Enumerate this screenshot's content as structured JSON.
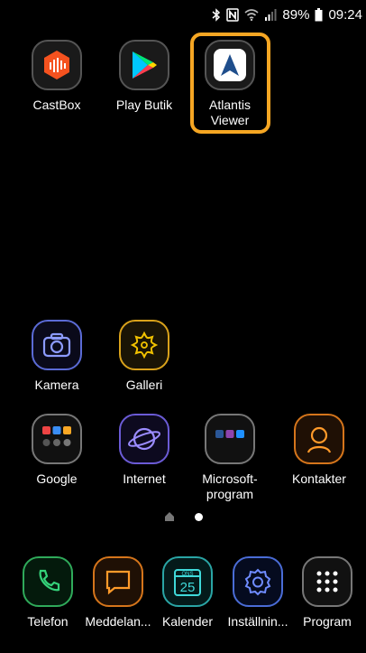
{
  "status_bar": {
    "battery_percent": "89%",
    "time": "09:24",
    "icons": [
      "bluetooth-icon",
      "nfc-icon",
      "wifi-icon",
      "signal-icon",
      "battery-icon"
    ]
  },
  "home_apps": [
    {
      "label": "CastBox",
      "icon": "castbox-icon"
    },
    {
      "label": "Play Butik",
      "icon": "play-store-icon"
    },
    {
      "label": "Atlantis Viewer",
      "icon": "atlantis-viewer-icon"
    }
  ],
  "mid_apps": [
    {
      "label": "Kamera",
      "icon": "camera-icon"
    },
    {
      "label": "Galleri",
      "icon": "gallery-icon"
    }
  ],
  "folder_apps": [
    {
      "label": "Google",
      "icon": "google-folder-icon"
    },
    {
      "label": "Internet",
      "icon": "internet-icon"
    },
    {
      "label": "Microsoft-program",
      "icon": "microsoft-folder-icon"
    },
    {
      "label": "Kontakter",
      "icon": "contacts-icon"
    }
  ],
  "dock": [
    {
      "label": "Telefon",
      "icon": "phone-icon"
    },
    {
      "label": "Meddelan...",
      "icon": "messages-icon"
    },
    {
      "label": "Kalender",
      "icon": "calendar-icon",
      "day": "25",
      "weekday": "ONS"
    },
    {
      "label": "Inställnin...",
      "icon": "settings-icon"
    },
    {
      "label": "Program",
      "icon": "app-drawer-icon"
    }
  ],
  "colors": {
    "highlight": "#f5a623",
    "background": "#000000"
  }
}
